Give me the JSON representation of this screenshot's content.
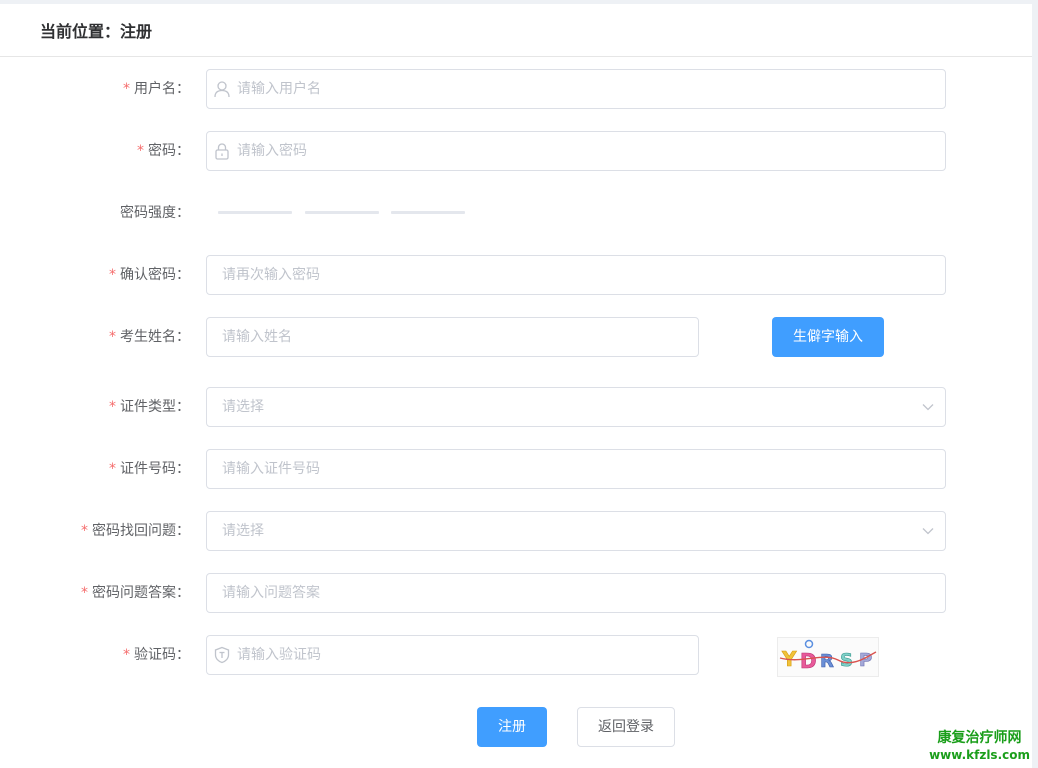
{
  "breadcrumb": {
    "text": "当前位置：注册"
  },
  "form": {
    "username": {
      "label": "用户名：",
      "placeholder": "请输入用户名"
    },
    "password": {
      "label": "密码：",
      "placeholder": "请输入密码"
    },
    "strength": {
      "label": "密码强度："
    },
    "confirm_password": {
      "label": "确认密码：",
      "placeholder": "请再次输入密码"
    },
    "name": {
      "label": "考生姓名：",
      "placeholder": "请输入姓名",
      "rare_char_button": "生僻字输入"
    },
    "id_type": {
      "label": "证件类型：",
      "placeholder": "请选择"
    },
    "id_number": {
      "label": "证件号码：",
      "placeholder": "请输入证件号码"
    },
    "question": {
      "label": "密码找回问题：",
      "placeholder": "请选择"
    },
    "answer": {
      "label": "密码问题答案：",
      "placeholder": "请输入问题答案"
    },
    "captcha": {
      "label": "验证码：",
      "placeholder": "请输入验证码",
      "image_text": "YDRSP"
    },
    "required_mark": "*"
  },
  "actions": {
    "register": "注册",
    "back_to_login": "返回登录"
  },
  "watermark": {
    "line1": "康复治疗师网",
    "line2": "www.kfzls.com"
  },
  "colors": {
    "primary": "#409eff",
    "required": "#f56c6c",
    "border": "#dcdfe6",
    "placeholder": "#c0c4cc",
    "watermark": "#1a9e1a"
  },
  "icons": {
    "username": "user-icon",
    "password": "lock-icon",
    "captcha": "shield-icon",
    "select_arrow": "chevron-down-icon"
  }
}
